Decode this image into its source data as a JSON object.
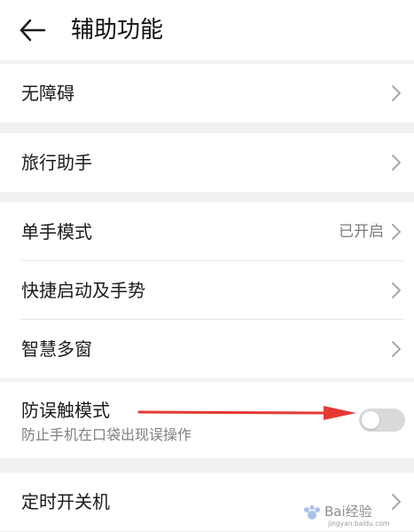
{
  "header": {
    "title": "辅助功能",
    "back_icon": "back-arrow-icon"
  },
  "groups": [
    {
      "items": [
        {
          "label": "无障碍",
          "icon": "chevron-right-icon"
        }
      ]
    },
    {
      "items": [
        {
          "label": "旅行助手",
          "icon": "chevron-right-icon"
        }
      ]
    },
    {
      "items": [
        {
          "label": "单手模式",
          "value": "已开启",
          "icon": "chevron-right-icon"
        },
        {
          "label": "快捷启动及手势",
          "icon": "chevron-right-icon"
        },
        {
          "label": "智慧多窗",
          "icon": "chevron-right-icon"
        }
      ]
    },
    {
      "items": [
        {
          "label": "防误触模式",
          "subtitle": "防止手机在口袋出现误操作",
          "toggle": false,
          "toggle_off_color": "#d9d9d9"
        }
      ]
    },
    {
      "items": [
        {
          "label": "定时开关机",
          "icon": "chevron-right-icon"
        }
      ]
    }
  ],
  "annotation": {
    "arrow_color": "#e53935"
  },
  "watermark": {
    "text": "Bai经验",
    "subtext": "jingyan.baidu.com"
  },
  "colors": {
    "background": "#f1f1f1",
    "card": "#ffffff",
    "text_primary": "#1b1b1b",
    "text_secondary": "#7f7f7f",
    "chevron": "#a8a8a8"
  }
}
